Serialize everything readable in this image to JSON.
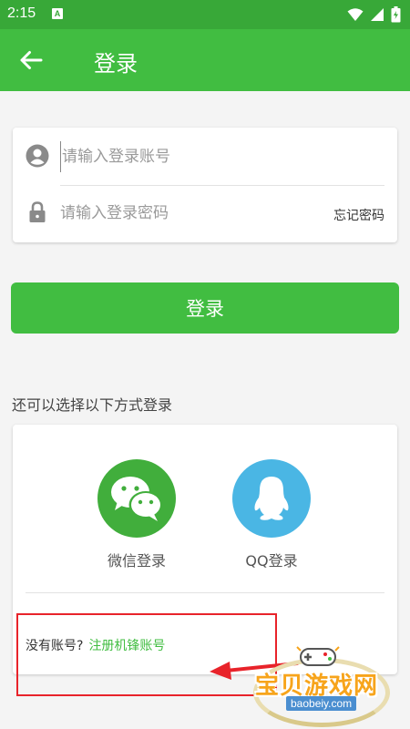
{
  "status_bar": {
    "time": "2:15",
    "app_badge": "A"
  },
  "app_bar": {
    "title": "登录"
  },
  "form": {
    "account_placeholder": "请输入登录账号",
    "password_placeholder": "请输入登录密码",
    "forgot_password": "忘记密码"
  },
  "login_button": {
    "label": "登录"
  },
  "other_login": {
    "label": "还可以选择以下方式登录",
    "options": [
      {
        "label": "微信登录",
        "icon": "wechat-icon",
        "color": "#41ae3c"
      },
      {
        "label": "QQ登录",
        "icon": "qq-penguin-icon",
        "color": "#4ab6e4"
      }
    ]
  },
  "register": {
    "prompt": "没有账号?",
    "link": "注册机锋账号"
  },
  "watermark": {
    "title": "宝贝游戏网",
    "url": "baobeiy.com"
  },
  "colors": {
    "primary": "#41bd41",
    "status_bar": "#38a838",
    "annotation": "#e8232a"
  }
}
